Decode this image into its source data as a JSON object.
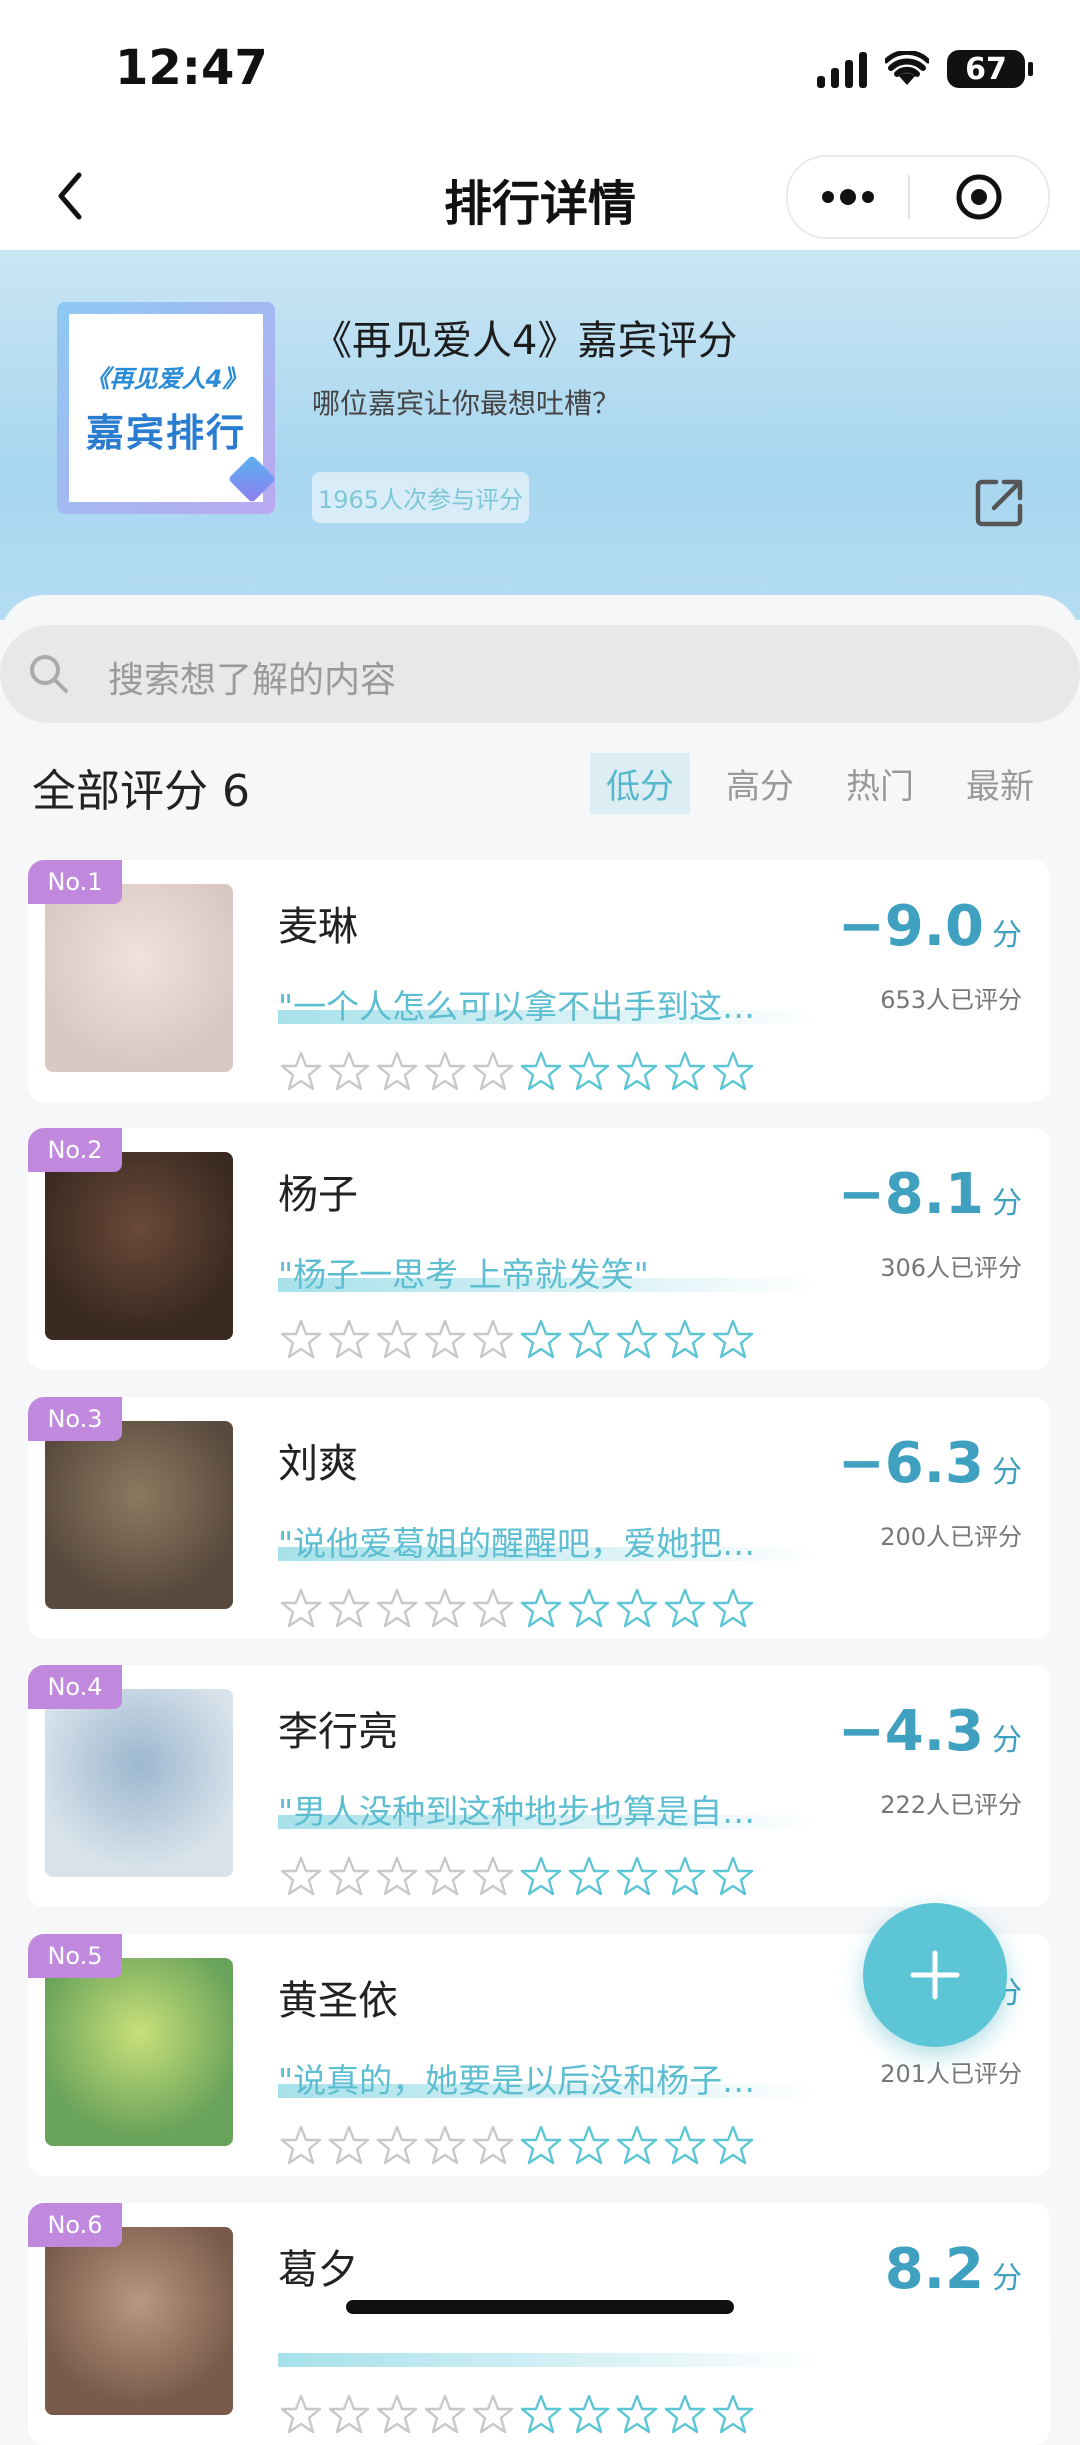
{
  "status": {
    "time": "12:47",
    "battery": "67"
  },
  "nav": {
    "title": "排行详情"
  },
  "header": {
    "cover_sub": "《再见爱人4》",
    "cover_main": "嘉宾排行",
    "title": "《再见爱人4》嘉宾评分",
    "subtitle": "哪位嘉宾让你最想吐槽？",
    "participants": "1965人次参与评分"
  },
  "search": {
    "placeholder": "搜索想了解的内容"
  },
  "filters": {
    "all_label": "全部评分 6",
    "tabs": [
      "低分",
      "高分",
      "热门",
      "最新"
    ],
    "active_tab": "低分"
  },
  "rankings": [
    {
      "rank": "No.1",
      "name": "麦琳",
      "quote": "\"一个人怎么可以拿不出手到这…",
      "score": "−9.0",
      "unit": "分",
      "votes": "653人已评分"
    },
    {
      "rank": "No.2",
      "name": "杨子",
      "quote": "\"杨子一思考 上帝就发笑\"",
      "score": "−8.1",
      "unit": "分",
      "votes": "306人已评分"
    },
    {
      "rank": "No.3",
      "name": "刘爽",
      "quote": "\"说他爱葛姐的醒醒吧，爱她把…",
      "score": "−6.3",
      "unit": "分",
      "votes": "200人已评分"
    },
    {
      "rank": "No.4",
      "name": "李行亮",
      "quote": "\"男人没种到这种地步也算是自…",
      "score": "−4.3",
      "unit": "分",
      "votes": "222人已评分"
    },
    {
      "rank": "No.5",
      "name": "黄圣依",
      "quote": "\"说真的，她要是以后没和杨子…",
      "score": "",
      "unit": "分",
      "votes": "201人已评分"
    },
    {
      "rank": "No.6",
      "name": "葛夕",
      "quote": "",
      "score": "8.2",
      "unit": "分",
      "votes": ""
    }
  ],
  "colors": {
    "accent": "#5cc6d6",
    "badge": "#c089de",
    "score": "#3fa0c0"
  }
}
